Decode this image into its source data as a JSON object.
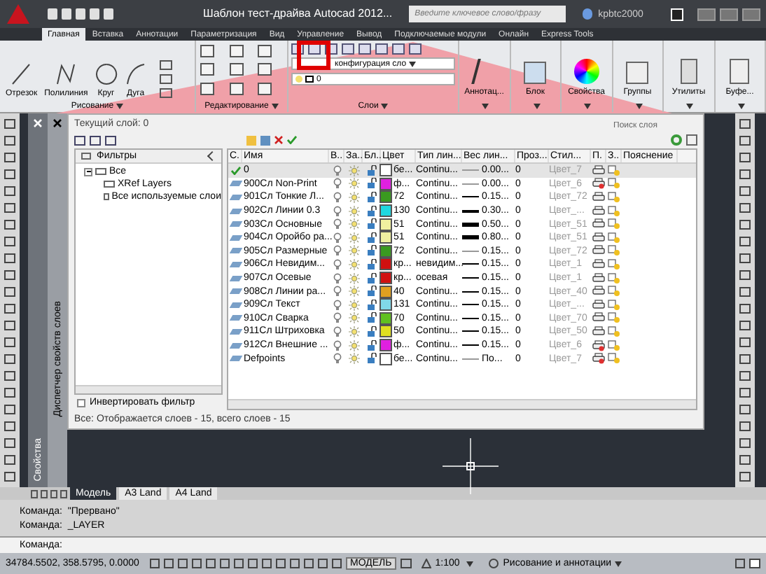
{
  "title_bar": {
    "title": "Шаблон тест-драйва Autocad 2012...",
    "search_placeholder": "Введите ключевое слово/фразу",
    "user": "kpbtc2000"
  },
  "ribbon_tabs": [
    {
      "label": "Главная",
      "selected": true
    },
    {
      "label": "Вставка",
      "selected": false
    },
    {
      "label": "Аннотации",
      "selected": false
    },
    {
      "label": "Параметризация",
      "selected": false
    },
    {
      "label": "Вид",
      "selected": false
    },
    {
      "label": "Управление",
      "selected": false
    },
    {
      "label": "Вывод",
      "selected": false
    },
    {
      "label": "Подключаемые модули",
      "selected": false
    },
    {
      "label": "Онлайн",
      "selected": false
    },
    {
      "label": "Express Tools",
      "selected": false
    }
  ],
  "ribbon": {
    "draw_tools": [
      "Отрезок",
      "Полилиния",
      "Круг",
      "Дуга"
    ],
    "layer_dropdown": "конфигурация сло",
    "layer_state": "0",
    "big_buttons": [
      "Аннотац...",
      "Блок",
      "Свойства",
      "Группы",
      "Утилиты",
      "Буфе..."
    ],
    "panels": [
      "Рисование",
      "Редактирование",
      "Слои"
    ]
  },
  "palettes": [
    "Свойства",
    "Диспетчер свойств слоев"
  ],
  "layer_manager": {
    "current_layer": "Текущий слой: 0",
    "search_placeholder": "Поиск слоя",
    "filters_header": "Фильтры",
    "filters": [
      {
        "label": "Все",
        "expanded": true,
        "children": [
          {
            "label": "XRef Layers"
          },
          {
            "label": "Все используемые слои"
          }
        ]
      }
    ],
    "invert_filter": {
      "label": "Инвертировать фильтр",
      "checked": false
    },
    "columns": [
      "С.",
      "Имя",
      "В..",
      "За..",
      "Бл..",
      "Цвет",
      "Тип лин...",
      "Вес лин...",
      "Проз...",
      "Стил...",
      "П.",
      "З..",
      "Пояснение"
    ],
    "rows": [
      {
        "current": true,
        "name": "0",
        "color_name": "бе...",
        "color": "#ffffff",
        "linetype": "Continu...",
        "kind": "thin",
        "lineweight": "0.00...",
        "transparency": "0",
        "plot_style": "Цвет_7",
        "plot": true
      },
      {
        "current": false,
        "name": "900Сл Non-Print",
        "color_name": "ф...",
        "color": "#e020e0",
        "linetype": "Continu...",
        "kind": "thin",
        "lineweight": "0.00...",
        "transparency": "0",
        "plot_style": "Цвет_6",
        "plot": false
      },
      {
        "current": false,
        "name": "901Сл Тонкие Л...",
        "color_name": "72",
        "color": "#3a9a20",
        "linetype": "Continu...",
        "kind": "normal",
        "lineweight": "0.15...",
        "transparency": "0",
        "plot_style": "Цвет_72",
        "plot": true
      },
      {
        "current": false,
        "name": "902Сл Линии 0.3",
        "color_name": "130",
        "color": "#20d8e0",
        "linetype": "Continu...",
        "kind": "bold",
        "lineweight": "0.30...",
        "transparency": "0",
        "plot_style": "Цвет_...",
        "plot": true
      },
      {
        "current": false,
        "name": "903Сл Основные",
        "color_name": "51",
        "color": "#f0f0a0",
        "linetype": "Continu...",
        "kind": "heavy",
        "lineweight": "0.50...",
        "transparency": "0",
        "plot_style": "Цвет_51",
        "plot": true
      },
      {
        "current": false,
        "name": "904Сл Оройбо ра...",
        "color_name": "51",
        "color": "#f0f0a0",
        "linetype": "Continu...",
        "kind": "heavy",
        "lineweight": "0.80...",
        "transparency": "0",
        "plot_style": "Цвет_51",
        "plot": true
      },
      {
        "current": false,
        "name": "905Сл Размерные",
        "color_name": "72",
        "color": "#3a9a20",
        "linetype": "Continu...",
        "kind": "thin",
        "lineweight": "0.15...",
        "transparency": "0",
        "plot_style": "Цвет_72",
        "plot": true
      },
      {
        "current": false,
        "name": "906Сл Невидим...",
        "color_name": "кр...",
        "color": "#d01010",
        "linetype": "невидим...",
        "kind": "normal",
        "lineweight": "0.15...",
        "transparency": "0",
        "plot_style": "Цвет_1",
        "plot": true
      },
      {
        "current": false,
        "name": "907Сл Осевые",
        "color_name": "кр...",
        "color": "#d01010",
        "linetype": "осевая",
        "kind": "normal",
        "lineweight": "0.15...",
        "transparency": "0",
        "plot_style": "Цвет_1",
        "plot": true
      },
      {
        "current": false,
        "name": "908Сл Линии ра...",
        "color_name": "40",
        "color": "#e0a020",
        "linetype": "Continu...",
        "kind": "normal",
        "lineweight": "0.15...",
        "transparency": "0",
        "plot_style": "Цвет_40",
        "plot": true
      },
      {
        "current": false,
        "name": "909Сл Текст",
        "color_name": "131",
        "color": "#80d8e8",
        "linetype": "Continu...",
        "kind": "normal",
        "lineweight": "0.15...",
        "transparency": "0",
        "plot_style": "Цвет_...",
        "plot": true
      },
      {
        "current": false,
        "name": "910Сл Сварка",
        "color_name": "70",
        "color": "#60c020",
        "linetype": "Continu...",
        "kind": "normal",
        "lineweight": "0.15...",
        "transparency": "0",
        "plot_style": "Цвет_70",
        "plot": true
      },
      {
        "current": false,
        "name": "911Сл Штриховка",
        "color_name": "50",
        "color": "#e0e020",
        "linetype": "Continu...",
        "kind": "normal",
        "lineweight": "0.15...",
        "transparency": "0",
        "plot_style": "Цвет_50",
        "plot": true
      },
      {
        "current": false,
        "name": "912Сл Внешние ...",
        "color_name": "ф...",
        "color": "#e020e0",
        "linetype": "Continu...",
        "kind": "normal",
        "lineweight": "0.15...",
        "transparency": "0",
        "plot_style": "Цвет_6",
        "plot": false
      },
      {
        "current": false,
        "name": "Defpoints",
        "color_name": "бе...",
        "color": "#ffffff",
        "linetype": "Continu...",
        "kind": "thin",
        "lineweight": "По...",
        "transparency": "0",
        "plot_style": "Цвет_7",
        "plot": false
      }
    ],
    "status": "Все: Отображается слоев - 15, всего слоев - 15"
  },
  "layout_tabs": [
    {
      "label": "Модель",
      "selected": true
    },
    {
      "label": "A3 Land",
      "selected": false
    },
    {
      "label": "A4 Land",
      "selected": false
    }
  ],
  "command_history": [
    "Команда:  \"Прервано\"",
    "Команда:  _LAYER"
  ],
  "command_prompt": "Команда:",
  "status_bar": {
    "coordinates": "34784.5502, 358.5795, 0.0000",
    "space": "МОДЕЛЬ",
    "scale": "1:100",
    "workspace": "Рисование и аннотации"
  }
}
